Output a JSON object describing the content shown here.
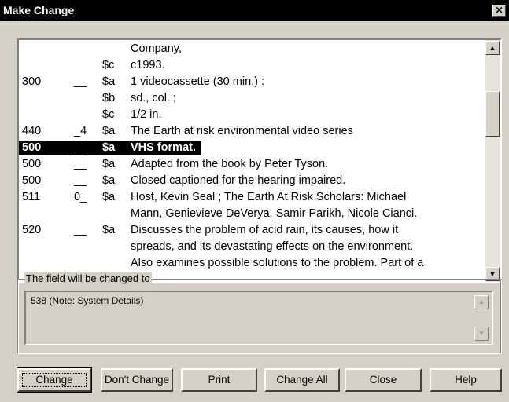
{
  "window": {
    "title": "Make Change",
    "close_label": "✕"
  },
  "record": {
    "rows": [
      {
        "tag": "",
        "ind": "",
        "sub": "",
        "text": "Company,"
      },
      {
        "tag": "",
        "ind": "",
        "sub": "$c",
        "text": "c1993."
      },
      {
        "tag": "300",
        "ind": "__",
        "sub": "$a",
        "text": "1 videocassette (30 min.) :"
      },
      {
        "tag": "",
        "ind": "",
        "sub": "$b",
        "text": "sd., col. ;"
      },
      {
        "tag": "",
        "ind": "",
        "sub": "$c",
        "text": "1/2 in."
      },
      {
        "tag": "440",
        "ind": "_4",
        "sub": "$a",
        "text": "The Earth at risk environmental video series"
      },
      {
        "tag": "500",
        "ind": "__",
        "sub": "$a",
        "text": "VHS format.",
        "selected": true
      },
      {
        "tag": "500",
        "ind": "__",
        "sub": "$a",
        "text": "Adapted from the book by Peter Tyson."
      },
      {
        "tag": "500",
        "ind": "__",
        "sub": "$a",
        "text": "Closed captioned for the hearing impaired."
      },
      {
        "tag": "511",
        "ind": "0_",
        "sub": "$a",
        "text": "Host, Kevin Seal ; The Earth At Risk Scholars: Michael"
      },
      {
        "tag": "",
        "ind": "",
        "sub": "",
        "text": "Mann, Genievieve DeVerya, Samir Parikh, Nicole Cianci."
      },
      {
        "tag": "520",
        "ind": "__",
        "sub": "$a",
        "text": "Discusses the problem of acid rain, its causes, how it"
      },
      {
        "tag": "",
        "ind": "",
        "sub": "",
        "text": "spreads, and its devastating effects on the environment."
      },
      {
        "tag": "",
        "ind": "",
        "sub": "",
        "text": "Also examines possible solutions to the problem. Part of a"
      }
    ]
  },
  "group": {
    "legend": "The field will be changed to",
    "value": "538 (Note: System Details)"
  },
  "buttons": {
    "change": "Change",
    "dont_change": "Don't Change",
    "print": "Print",
    "change_all": "Change All",
    "close": "Close",
    "help": "Help"
  },
  "icons": {
    "up_arrow": "▲",
    "down_arrow": "▼"
  }
}
